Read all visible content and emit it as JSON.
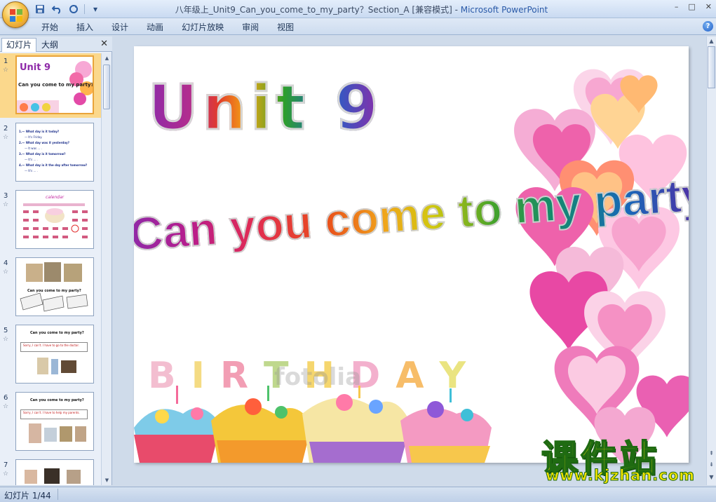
{
  "window": {
    "title": "八年级上_Unit9_Can_you_come_to_my_party？Section_A [兼容模式]",
    "app_name": "Microsoft PowerPoint",
    "controls": [
      "–",
      "□",
      "✕"
    ]
  },
  "ribbon": {
    "tabs": [
      "开始",
      "插入",
      "设计",
      "动画",
      "幻灯片放映",
      "审阅",
      "视图"
    ]
  },
  "left_panel": {
    "tab_slides": "幻灯片",
    "tab_outline": "大纲",
    "close_glyph": "✕",
    "thumbnails": [
      {
        "num": "1",
        "title": "Unit 9",
        "subtitle": "Can you come to my party?"
      },
      {
        "num": "2",
        "lines": [
          "1.— What day is it today?",
          "— It's Friday.",
          "2.— What day was it yesterday?",
          "— It was ... .",
          "3.— What day is it tomorrow?",
          "— It's ... .",
          "4.— What day is it the day after tomorrow?",
          "— It's ... ."
        ]
      },
      {
        "num": "3",
        "heading": "calendar"
      },
      {
        "num": "4",
        "caption": "Can you come to my party?"
      },
      {
        "num": "5",
        "caption": "Can you come to my party?",
        "note": "Sorry, I can't. I have to go to the doctor."
      },
      {
        "num": "6",
        "caption": "Can you come to my party?",
        "note": "Sorry, I can't. I have to help my parents."
      },
      {
        "num": "7"
      }
    ]
  },
  "slide": {
    "title": "Unit 9",
    "subtitle": "Can you come to my party?",
    "banner_letters": [
      "B",
      "I",
      "R",
      "T",
      "H",
      "D",
      "A",
      "Y"
    ],
    "stock_watermark": "fotolia"
  },
  "status": {
    "slide_info": "幻灯片 1/44"
  },
  "watermark": {
    "brand": "课件站",
    "url": "www.kjzhan.com"
  },
  "colors": {
    "unit_title": [
      "#8e2aa8",
      "#e23a2c",
      "#f4a712",
      "#2e9f2a",
      "#1b66c9",
      "#8e2aa8"
    ],
    "subtitle_letters": [
      "#8e2aa8",
      "#b81c8c",
      "#e02b55",
      "#e94b1b",
      "#f0a51a",
      "#b3c413",
      "#44a32a",
      "#138a6e",
      "#1868b8",
      "#4a36a8",
      "#8e2aa8"
    ]
  }
}
